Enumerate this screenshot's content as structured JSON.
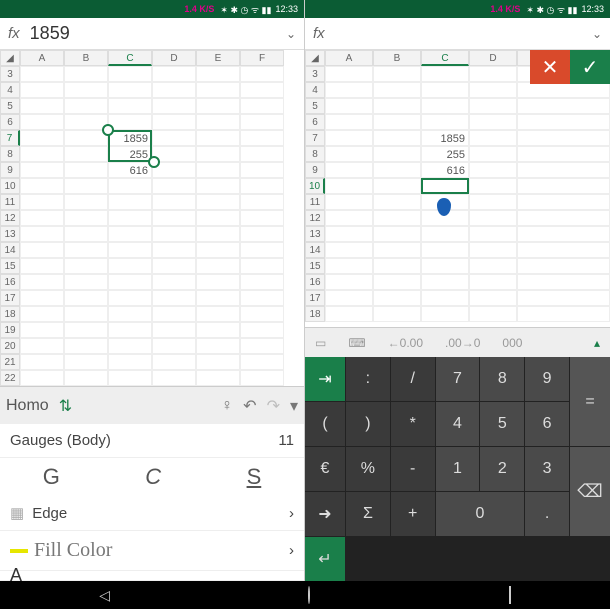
{
  "left": {
    "status": {
      "speed": "1.4 K/S",
      "time": "12:33"
    },
    "formula": {
      "value": "1859"
    },
    "columns": [
      "A",
      "B",
      "C",
      "D",
      "E",
      "F"
    ],
    "rows": [
      "3",
      "4",
      "5",
      "6",
      "7",
      "8",
      "9",
      "10",
      "11",
      "12",
      "13",
      "14",
      "15",
      "16",
      "17",
      "18",
      "19",
      "20",
      "21",
      "22"
    ],
    "cells": {
      "C7": "1859",
      "C8": "255",
      "C9": "616"
    },
    "toolbar": {
      "font": "Homo"
    },
    "drawer": {
      "gauges_label": "Gauges (Body)",
      "gauges_value": "11",
      "style_g": "G",
      "style_c": "C",
      "style_s": "S",
      "edge_label": "Edge",
      "fill_label": "Fill Color"
    }
  },
  "right": {
    "status": {
      "speed": "1.4 K/S",
      "time": "12:33"
    },
    "formula": {
      "value": ""
    },
    "columns": [
      "A",
      "B",
      "C",
      "D"
    ],
    "rows": [
      "3",
      "4",
      "5",
      "6",
      "7",
      "8",
      "9",
      "10",
      "11",
      "12",
      "13",
      "14",
      "15",
      "16",
      "17",
      "18"
    ],
    "cells": {
      "C7": "1859",
      "C8": "255",
      "C9": "616"
    },
    "numtools": {
      "dec_dec": "←0\n.00",
      "dec_inc": ".00\n→0",
      "thou": "000"
    },
    "keys": {
      "tab": "⇥",
      "colon": ":",
      "slash": "/",
      "k7": "7",
      "k8": "8",
      "k9": "9",
      "eq": "=",
      "lp": "(",
      "rp": ")",
      "star": "*",
      "k4": "4",
      "k5": "5",
      "k6": "6",
      "eur": "€",
      "pct": "%",
      "minus": "-",
      "k1": "1",
      "k2": "2",
      "k3": "3",
      "bk": "⌫",
      "arr": "➜",
      "sig": "Σ",
      "plus": "+",
      "k0": "0",
      "dot": ".",
      "ent": "↵"
    }
  },
  "nav": {
    "back": "◁",
    "home": "○",
    "recent": "□"
  }
}
